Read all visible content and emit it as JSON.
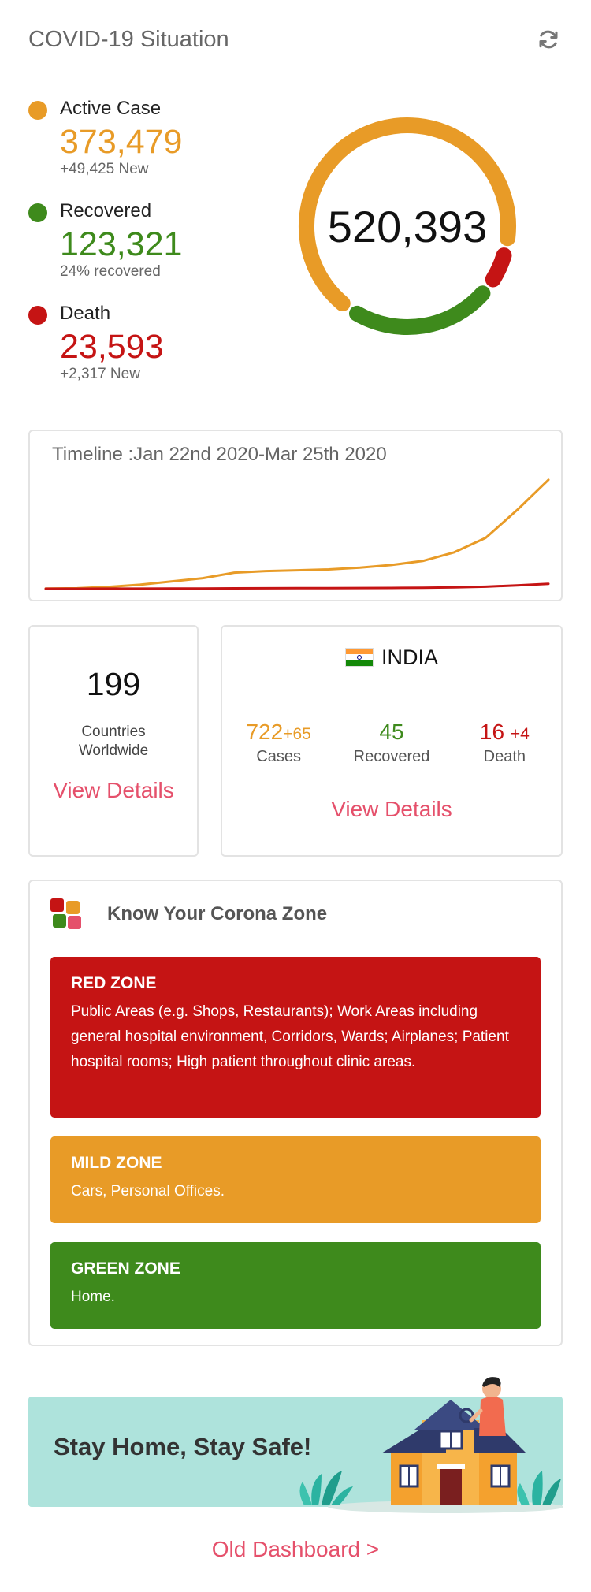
{
  "header": {
    "title": "COVID-19 Situation",
    "refresh_icon": "refresh-icon"
  },
  "stats": {
    "active": {
      "label": "Active Case",
      "value": "373,479",
      "sub": "+49,425 New",
      "color": "#e89b27"
    },
    "recovered": {
      "label": "Recovered",
      "value": "123,321",
      "sub": "24% recovered",
      "color": "#3e8a1c"
    },
    "death": {
      "label": "Death",
      "value": "23,593",
      "sub": "+2,317 New",
      "color": "#c51414"
    }
  },
  "donut": {
    "total": "520,393",
    "segments": [
      {
        "name": "Active Case",
        "value": 373479,
        "color": "#e89b27"
      },
      {
        "name": "Death",
        "value": 23593,
        "color": "#c51414"
      },
      {
        "name": "Recovered",
        "value": 123321,
        "color": "#3e8a1c"
      }
    ]
  },
  "timeline": {
    "title": "Timeline :Jan 22nd 2020-Mar 25th 2020"
  },
  "chart_data": {
    "type": "line",
    "title": "Timeline :Jan 22nd 2020-Mar 25th 2020",
    "x": [
      "2020-01-22",
      "2020-01-26",
      "2020-01-30",
      "2020-02-03",
      "2020-02-07",
      "2020-02-11",
      "2020-02-15",
      "2020-02-19",
      "2020-02-23",
      "2020-02-27",
      "2020-03-02",
      "2020-03-06",
      "2020-03-10",
      "2020-03-14",
      "2020-03-18",
      "2020-03-22",
      "2020-03-25"
    ],
    "series": [
      {
        "color": "#e89b27",
        "values": [
          555,
          2100,
          8200,
          17400,
          31500,
          45200,
          69000,
          75600,
          79200,
          82800,
          90300,
          101800,
          119000,
          156000,
          218000,
          337000,
          467000
        ]
      },
      {
        "color": "#c51414",
        "values": [
          17,
          56,
          171,
          362,
          638,
          1018,
          1666,
          2122,
          2469,
          2810,
          3085,
          3460,
          4262,
          5819,
          8758,
          14642,
          21181
        ]
      }
    ],
    "ylim": [
      0,
      480000
    ]
  },
  "countries": {
    "count": "199",
    "label": "Countries Worldwide",
    "link": "View Details"
  },
  "india": {
    "name": "INDIA",
    "flag_colors": [
      "#ff9933",
      "#ffffff",
      "#138808"
    ],
    "cases": {
      "value": "722",
      "delta": "+65",
      "caption": "Cases",
      "color": "#e89b27"
    },
    "recovered": {
      "value": "45",
      "caption": "Recovered",
      "color": "#3e8a1c"
    },
    "death": {
      "value": "16",
      "delta": "+4",
      "caption": "Death",
      "color": "#c51414"
    },
    "link": "View Details"
  },
  "zones": {
    "heading": "Know Your Corona Zone",
    "items": [
      {
        "title": "RED ZONE",
        "text": "Public Areas (e.g. Shops, Restaurants); Work Areas including general hospital environment, Corridors, Wards; Airplanes; Patient hospital rooms; High patient throughout clinic areas.",
        "color": "#c51414"
      },
      {
        "title": "MILD ZONE",
        "text": "Cars, Personal Offices.",
        "color": "#e89b27"
      },
      {
        "title": "GREEN ZONE",
        "text": "Home.",
        "color": "#3e8a1c"
      }
    ]
  },
  "banner": {
    "text": "Stay Home, Stay Safe!"
  },
  "footer": {
    "old_dashboard": "Old Dashboard >"
  }
}
